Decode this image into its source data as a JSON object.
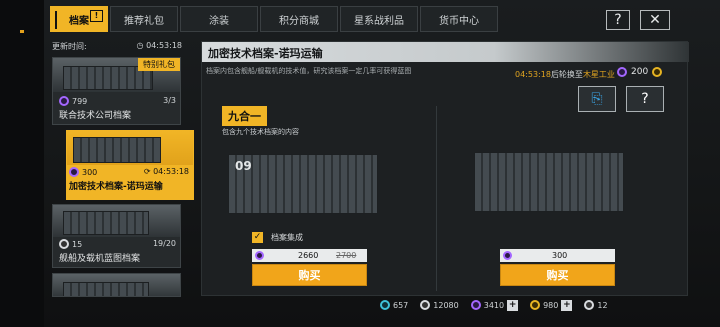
{
  "tabs": [
    {
      "label": "档案",
      "badge": "!",
      "active": true
    },
    {
      "label": "推荐礼包"
    },
    {
      "label": "涂装"
    },
    {
      "label": "积分商城"
    },
    {
      "label": "星系战利品"
    },
    {
      "label": "货币中心"
    }
  ],
  "top_buttons": {
    "help": "?",
    "close": "✕"
  },
  "left": {
    "header_label": "更新时间:",
    "header_timer": "04:53:18",
    "cards": [
      {
        "title": "联合技术公司档案",
        "badge": "特别礼包",
        "price": "799",
        "count": "3/3"
      },
      {
        "title": "加密技术档案-诺玛运输",
        "price": "300",
        "timer": "04:53:18",
        "selected": true
      },
      {
        "title": "舰船及载机蓝图档案",
        "price": "15",
        "count": "19/20"
      }
    ]
  },
  "main": {
    "title": "加密技术档案-诺玛运输",
    "description": "档案内包含舰船/舰载机的技术值，研究该档案一定几率可获得蓝图",
    "rotate_time": "04:53:18",
    "rotate_text": "后轮换至",
    "rotate_target": "木星工业",
    "top_price": "200",
    "icon_buttons": {
      "archive_icon": "archive-icon",
      "help": "?"
    },
    "bundle_label": "九合一",
    "bundle_sub": "包含九个技术档案的内容",
    "option_label": "档案集成",
    "left_offer": {
      "price": "2660",
      "old_price": "2700",
      "buy_label": "购买",
      "crate_code": "09"
    },
    "right_offer": {
      "price": "300",
      "buy_label": "购买"
    }
  },
  "currency": [
    {
      "icon": "cyan",
      "value": "657"
    },
    {
      "icon": "white",
      "value": "12080"
    },
    {
      "icon": "purple",
      "value": "3410",
      "plus": true
    },
    {
      "icon": "gold",
      "value": "980",
      "plus": true
    },
    {
      "icon": "white",
      "value": "12"
    }
  ]
}
